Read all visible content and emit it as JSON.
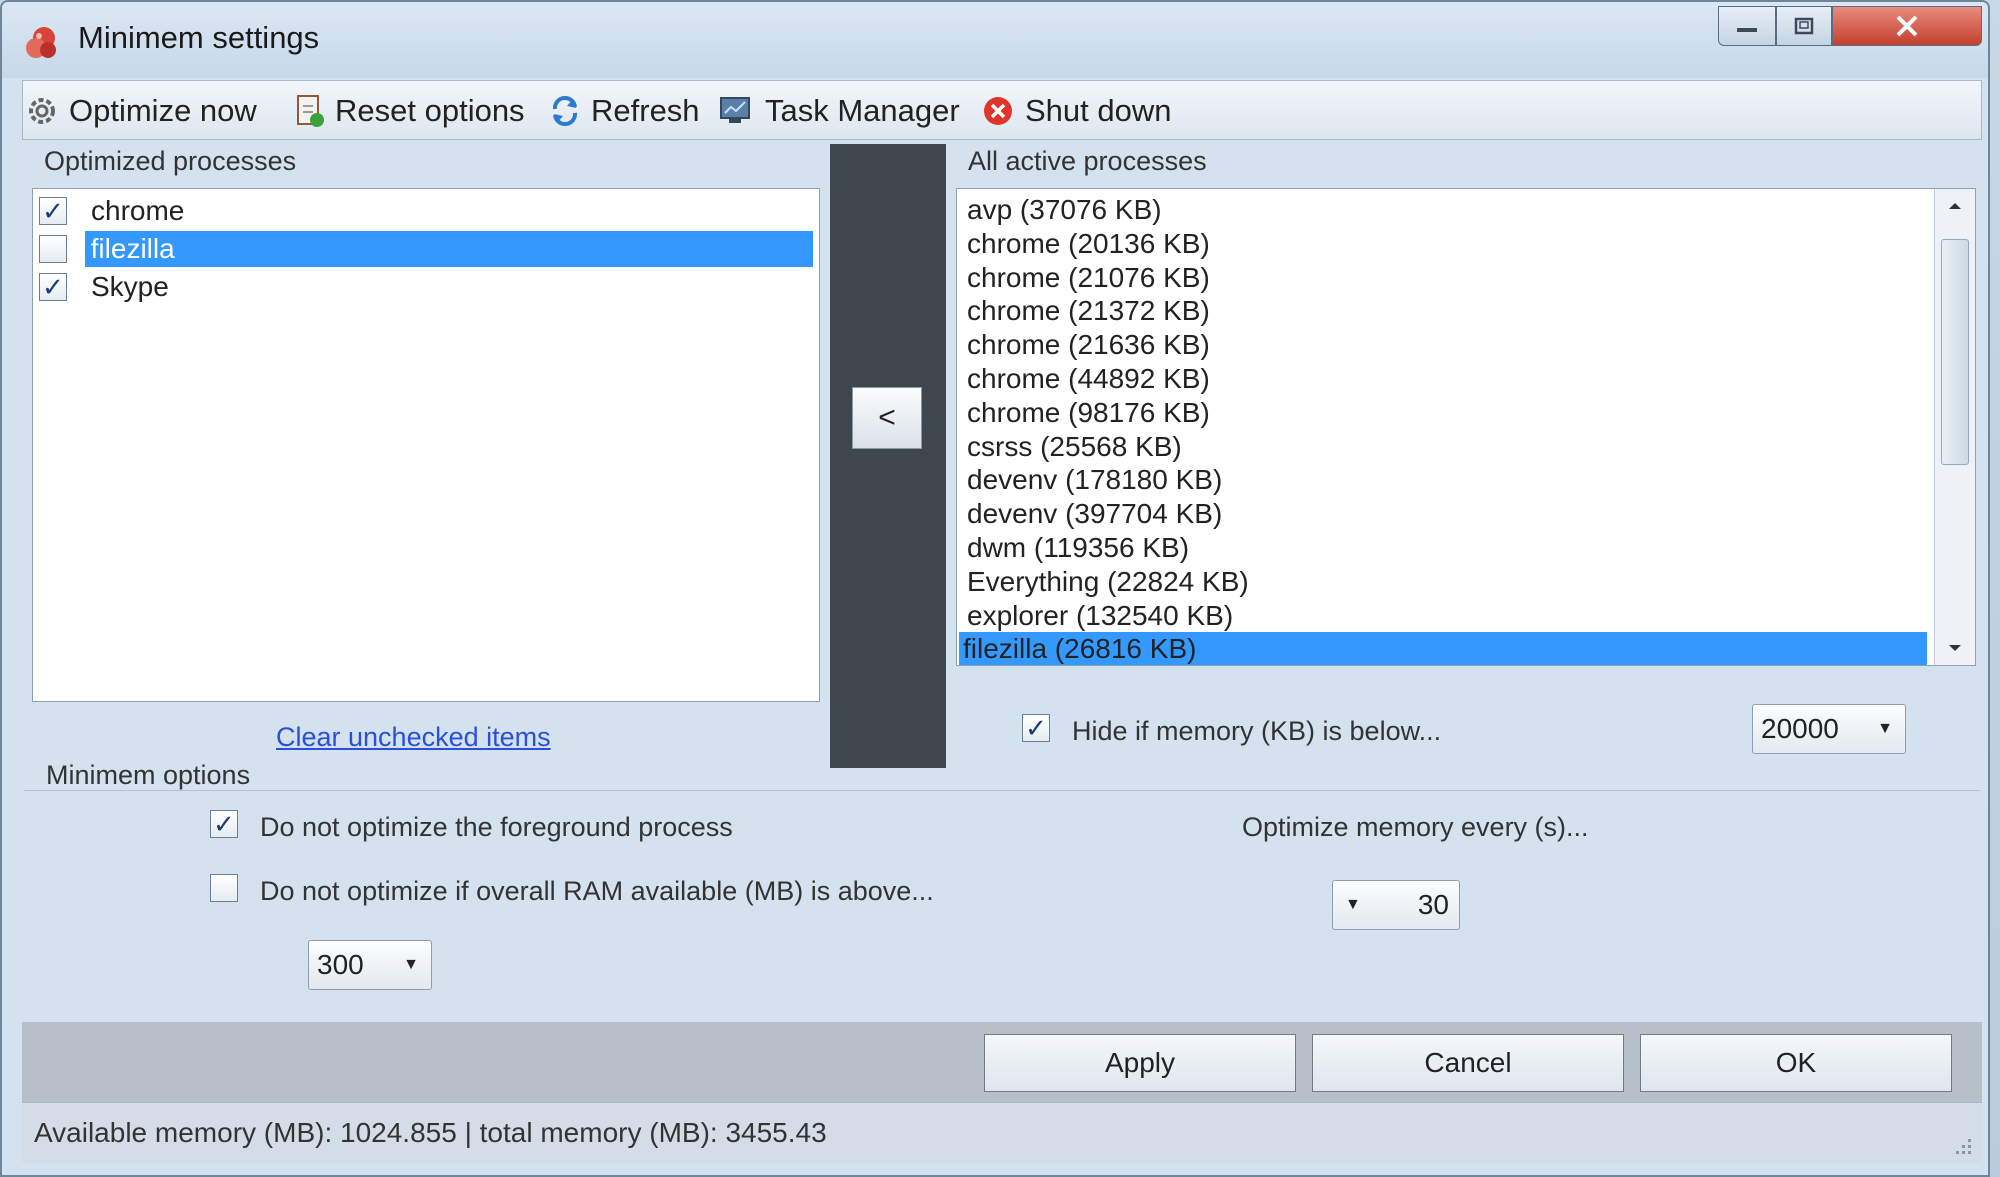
{
  "window": {
    "title": "Minimem settings"
  },
  "toolbar": {
    "items": [
      {
        "label": "Optimize now",
        "icon": "gear-icon"
      },
      {
        "label": "Reset options",
        "icon": "reset-icon"
      },
      {
        "label": "Refresh",
        "icon": "refresh-icon"
      },
      {
        "label": "Task Manager",
        "icon": "task-manager-icon"
      },
      {
        "label": "Shut down",
        "icon": "shutdown-icon"
      }
    ]
  },
  "optimized": {
    "label": "Optimized processes",
    "items": [
      {
        "name": "chrome",
        "checked": true,
        "selected": false
      },
      {
        "name": "filezilla",
        "checked": false,
        "selected": true
      },
      {
        "name": "Skype",
        "checked": true,
        "selected": false
      }
    ],
    "clear_link": "Clear unchecked items"
  },
  "move_button": {
    "label": "<"
  },
  "active": {
    "label": "All active processes",
    "items": [
      "avp (37076 KB)",
      "chrome (20136 KB)",
      "chrome (21076 KB)",
      "chrome (21372 KB)",
      "chrome (21636 KB)",
      "chrome (44892 KB)",
      "chrome (98176 KB)",
      "csrss (25568 KB)",
      "devenv (178180 KB)",
      "devenv (397704 KB)",
      "dwm (119356 KB)",
      "Everything (22824 KB)",
      "explorer (132540 KB)",
      "filezilla (26816 KB)"
    ],
    "selected_index": 13,
    "hide_label": "Hide if memory (KB) is below...",
    "hide_checked": true,
    "hide_threshold": "20000"
  },
  "options": {
    "label": "Minimem options",
    "foreground_label": "Do not optimize the foreground process",
    "foreground_checked": true,
    "ram_label": "Do not optimize if overall RAM available (MB) is above...",
    "ram_checked": false,
    "ram_value": "300",
    "interval_label": "Optimize memory every (s)...",
    "interval_value": "30"
  },
  "buttons": {
    "apply": "Apply",
    "cancel": "Cancel",
    "ok": "OK"
  },
  "status": {
    "available": "Available memory (MB): 1024.855",
    "separator": " | ",
    "total": "total memory (MB): 3455.43"
  },
  "colors": {
    "selection": "#3399ff",
    "close": "#c3402c",
    "link": "#2a4fd8"
  }
}
